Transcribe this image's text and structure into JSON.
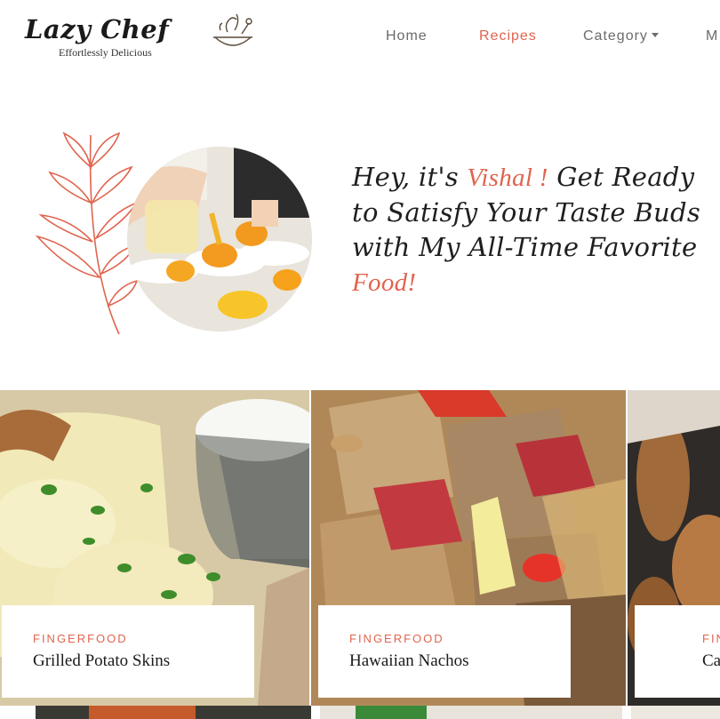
{
  "header": {
    "logo_title": "Lazy Chef",
    "logo_tagline": "Effortlessly Delicious",
    "logo_icon": "chef-bowl-icon"
  },
  "nav": {
    "items": [
      {
        "label": "Home",
        "active": false
      },
      {
        "label": "Recipes",
        "active": true
      },
      {
        "label": "Category",
        "active": false,
        "dropdown": true
      },
      {
        "label": "M",
        "active": false
      }
    ]
  },
  "hero": {
    "line_prefix": "Hey, it's ",
    "name": "Vishal !",
    "line_mid": " Get Ready to Satisfy Your Taste Buds with My All-Time Favorite ",
    "accent_end": "Food!",
    "image_icon": "chef-plating-photo",
    "decor_icon": "leaf-branch-icon"
  },
  "cards": [
    {
      "category": "FINGERFOOD",
      "title": "Grilled Potato Skins",
      "image": "potato-skins-photo"
    },
    {
      "category": "FINGERFOOD",
      "title": "Hawaiian Nachos",
      "image": "nachos-photo"
    },
    {
      "category": "FIN",
      "title": "Ca",
      "image": "fried-wings-photo"
    }
  ],
  "colors": {
    "accent": "#e0644e",
    "nav_text": "#6b6b6b",
    "heading": "#1f1f1f"
  }
}
